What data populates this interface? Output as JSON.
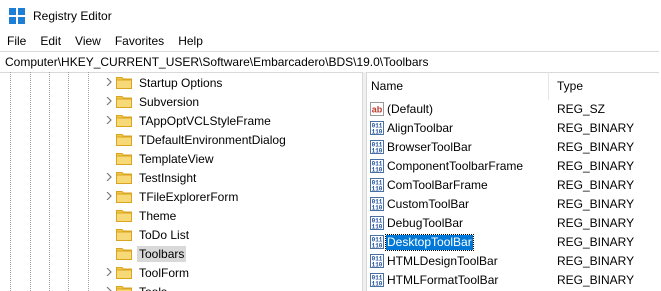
{
  "window": {
    "title": "Registry Editor"
  },
  "menu": [
    "File",
    "Edit",
    "View",
    "Favorites",
    "Help"
  ],
  "address": "Computer\\HKEY_CURRENT_USER\\Software\\Embarcadero\\BDS\\19.0\\Toolbars",
  "tree": {
    "items": [
      {
        "label": "Startup Options",
        "expandable": true,
        "selected": false
      },
      {
        "label": "Subversion",
        "expandable": true,
        "selected": false
      },
      {
        "label": "TAppOptVCLStyleFrame",
        "expandable": true,
        "selected": false
      },
      {
        "label": "TDefaultEnvironmentDialog",
        "expandable": false,
        "selected": false
      },
      {
        "label": "TemplateView",
        "expandable": false,
        "selected": false
      },
      {
        "label": "TestInsight",
        "expandable": true,
        "selected": false
      },
      {
        "label": "TFileExplorerForm",
        "expandable": true,
        "selected": false
      },
      {
        "label": "Theme",
        "expandable": false,
        "selected": false
      },
      {
        "label": "ToDo List",
        "expandable": false,
        "selected": false
      },
      {
        "label": "Toolbars",
        "expandable": false,
        "selected": true
      },
      {
        "label": "ToolForm",
        "expandable": true,
        "selected": false
      },
      {
        "label": "Tools",
        "expandable": true,
        "selected": false
      }
    ]
  },
  "list": {
    "columns": {
      "name": "Name",
      "type": "Type"
    },
    "rows": [
      {
        "name": "(Default)",
        "type": "REG_SZ",
        "icon": "string-value-icon",
        "selected": false
      },
      {
        "name": "AlignToolbar",
        "type": "REG_BINARY",
        "icon": "binary-value-icon",
        "selected": false
      },
      {
        "name": "BrowserToolBar",
        "type": "REG_BINARY",
        "icon": "binary-value-icon",
        "selected": false
      },
      {
        "name": "ComponentToolbarFrame",
        "type": "REG_BINARY",
        "icon": "binary-value-icon",
        "selected": false
      },
      {
        "name": "ComToolBarFrame",
        "type": "REG_BINARY",
        "icon": "binary-value-icon",
        "selected": false
      },
      {
        "name": "CustomToolBar",
        "type": "REG_BINARY",
        "icon": "binary-value-icon",
        "selected": false
      },
      {
        "name": "DebugToolBar",
        "type": "REG_BINARY",
        "icon": "binary-value-icon",
        "selected": false
      },
      {
        "name": "DesktopToolBar",
        "type": "REG_BINARY",
        "icon": "binary-value-icon",
        "selected": true
      },
      {
        "name": "HTMLDesignToolBar",
        "type": "REG_BINARY",
        "icon": "binary-value-icon",
        "selected": false
      },
      {
        "name": "HTMLFormatToolBar",
        "type": "REG_BINARY",
        "icon": "binary-value-icon",
        "selected": false
      }
    ]
  },
  "colors": {
    "selection": "#0078d7",
    "folder": "#f0c94a",
    "tree_selection": "#d9d9d9"
  }
}
